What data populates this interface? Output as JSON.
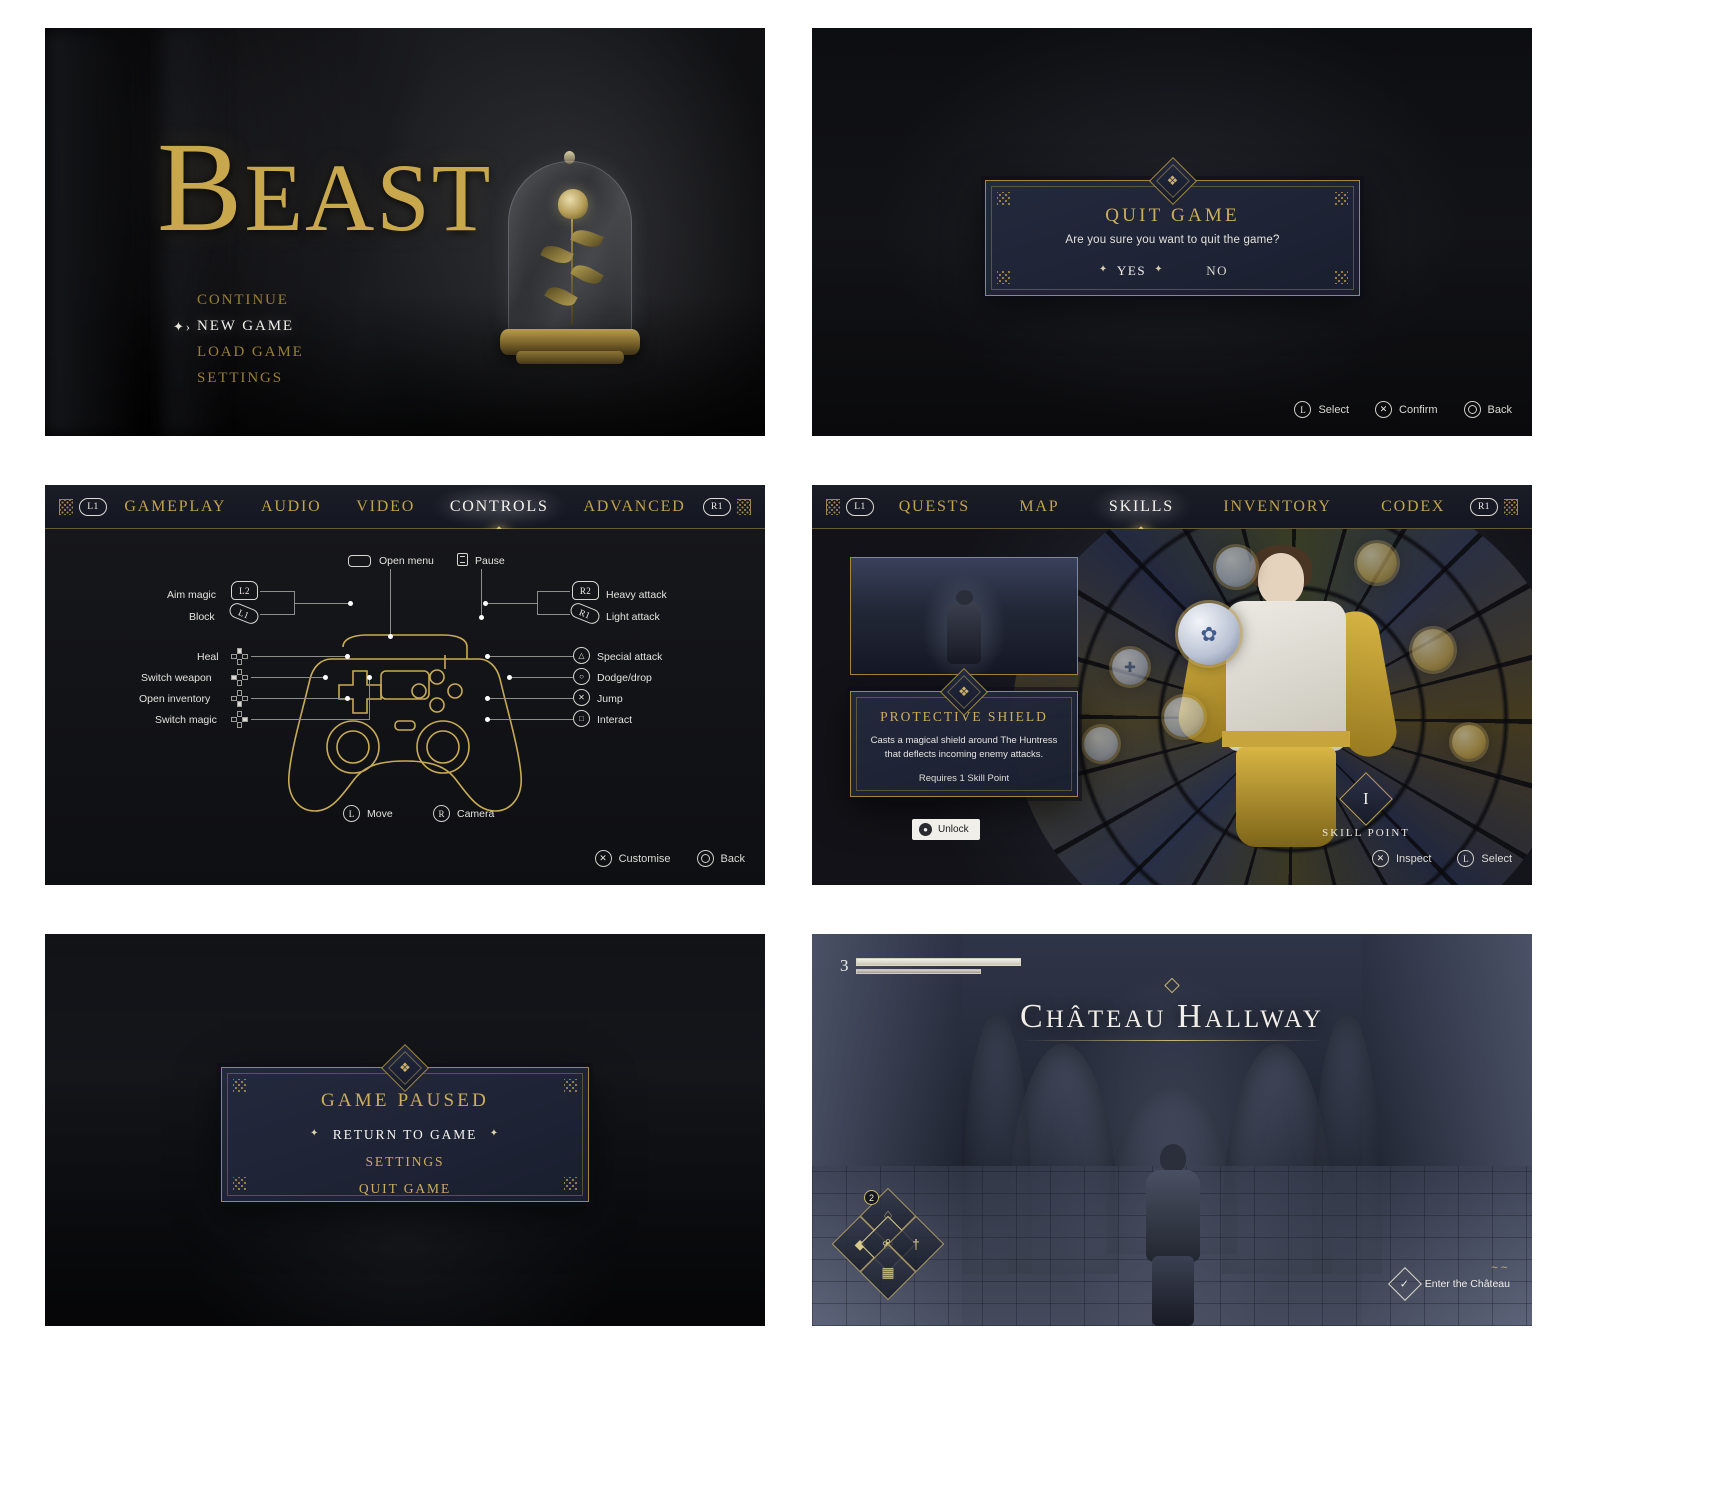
{
  "title_screen": {
    "game_title": "Beast",
    "menu": [
      {
        "label": "CONTINUE",
        "active": false
      },
      {
        "label": "NEW GAME",
        "active": true
      },
      {
        "label": "LOAD GAME",
        "active": false
      },
      {
        "label": "SETTINGS",
        "active": false
      }
    ],
    "caret_icon": "selection-flourish-icon"
  },
  "quit_dialog": {
    "title": "QUIT GAME",
    "message": "Are you sure you want to quit the game?",
    "yes_label": "YES",
    "no_label": "NO",
    "prompts": [
      {
        "icon": "left-stick-icon",
        "glyph": "L",
        "label": "Select"
      },
      {
        "icon": "cross-button-icon",
        "glyph": "✕",
        "label": "Confirm"
      },
      {
        "icon": "circle-button-icon",
        "glyph": "",
        "label": "Back"
      }
    ]
  },
  "settings_screen": {
    "bumper_left": "L1",
    "bumper_right": "R1",
    "tabs": [
      {
        "label": "GAMEPLAY",
        "active": false
      },
      {
        "label": "AUDIO",
        "active": false
      },
      {
        "label": "VIDEO",
        "active": false
      },
      {
        "label": "CONTROLS",
        "active": true
      },
      {
        "label": "ADVANCED",
        "active": false
      }
    ],
    "left_bindings": [
      {
        "label": "Aim magic",
        "button": "L2"
      },
      {
        "label": "Block",
        "button": "L1"
      },
      {
        "label": "Heal",
        "button": "dpad-up"
      },
      {
        "label": "Switch weapon",
        "button": "dpad-left"
      },
      {
        "label": "Open inventory",
        "button": "dpad-down"
      },
      {
        "label": "Switch magic",
        "button": "dpad-right"
      }
    ],
    "top_bindings": [
      {
        "label": "Open menu",
        "button": "touchpad"
      },
      {
        "label": "Pause",
        "button": "options"
      }
    ],
    "right_bindings": [
      {
        "label": "Heavy attack",
        "button": "R2"
      },
      {
        "label": "Light attack",
        "button": "R1"
      },
      {
        "label": "Special attack",
        "button": "△"
      },
      {
        "label": "Dodge/drop",
        "button": "○"
      },
      {
        "label": "Jump",
        "button": "✕"
      },
      {
        "label": "Interact",
        "button": "□"
      }
    ],
    "stick_bindings": [
      {
        "label": "Move",
        "button": "L"
      },
      {
        "label": "Camera",
        "button": "R"
      }
    ],
    "prompts": [
      {
        "icon": "cross-button-icon",
        "glyph": "✕",
        "label": "Customise"
      },
      {
        "icon": "circle-button-icon",
        "glyph": "",
        "label": "Back"
      }
    ]
  },
  "skills_screen": {
    "bumper_left": "L1",
    "bumper_right": "R1",
    "tabs": [
      {
        "label": "QUESTS",
        "active": false
      },
      {
        "label": "MAP",
        "active": false
      },
      {
        "label": "SKILLS",
        "active": true
      },
      {
        "label": "INVENTORY",
        "active": false
      },
      {
        "label": "CODEX",
        "active": false
      }
    ],
    "skill": {
      "name": "PROTECTIVE SHIELD",
      "description": "Casts a magical shield around The Huntress that deflects incoming enemy attacks.",
      "requirement": "Requires 1 Skill Point",
      "unlock_label": "Unlock",
      "unlock_icon": "unlock-button-icon"
    },
    "skill_point": {
      "value": "I",
      "label": "SKILL POINT"
    },
    "prompts": [
      {
        "icon": "cross-button-icon",
        "glyph": "✕",
        "label": "Inspect"
      },
      {
        "icon": "left-stick-icon",
        "glyph": "L",
        "label": "Select"
      }
    ]
  },
  "pause_screen": {
    "title": "GAME PAUSED",
    "menu": [
      {
        "label": "RETURN TO GAME",
        "active": true
      },
      {
        "label": "SETTINGS",
        "active": false
      },
      {
        "label": "QUIT GAME",
        "active": false
      }
    ]
  },
  "hud_screen": {
    "location": "Château Hallway",
    "level": "3",
    "quickslot_count": "2",
    "interact_label": "Enter the Château",
    "interact_icon": "checkmark-diamond-icon"
  },
  "colors": {
    "gold": "#c8a84b",
    "gold_light": "#cdae5d",
    "panel_navy": "#242a3e",
    "white_text": "#f0efe9"
  }
}
